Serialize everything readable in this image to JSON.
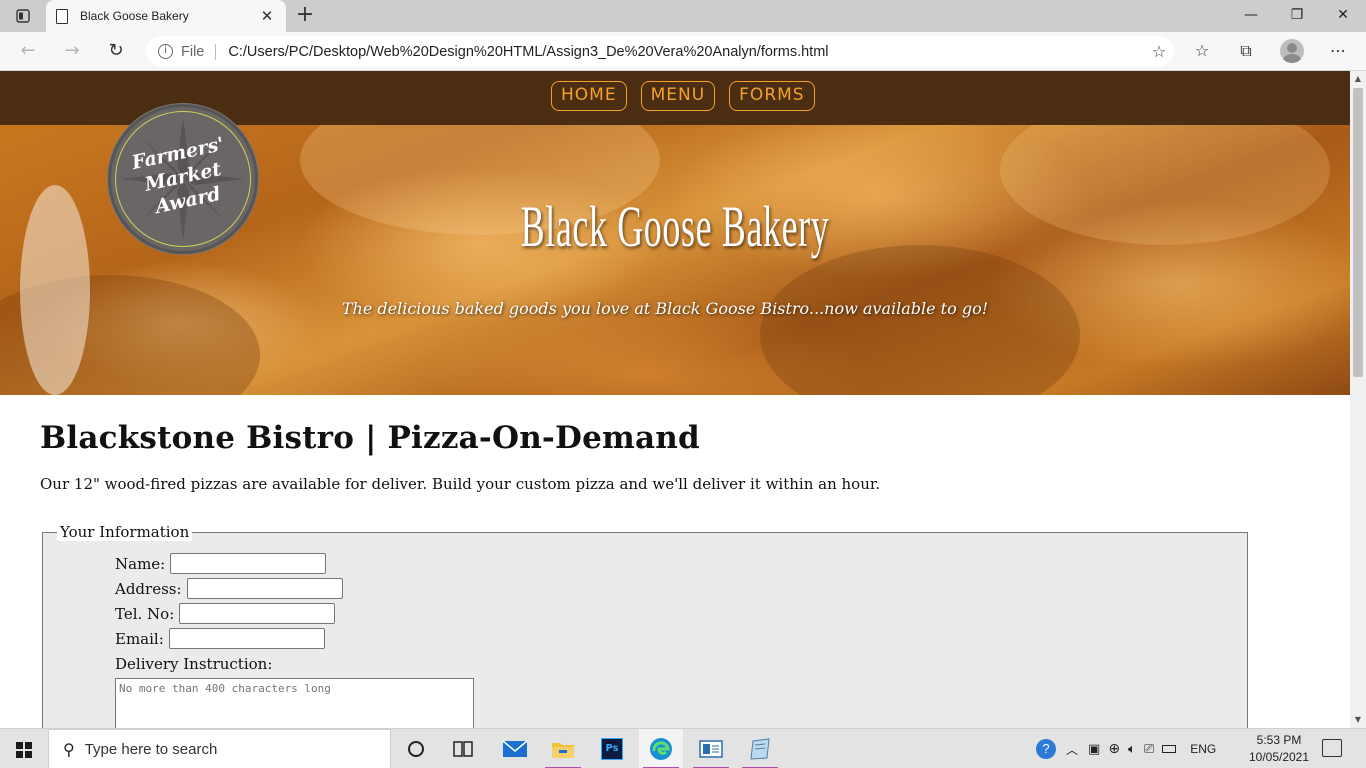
{
  "browser": {
    "tab_title": "Black Goose Bakery",
    "address_prefix": "File",
    "url": "C:/Users/PC/Desktop/Web%20Design%20HTML/Assign3_De%20Vera%20Analyn/forms.html",
    "icons": [
      "tab-actions-icon",
      "page-icon",
      "close-icon",
      "new-tab-icon",
      "minimize-icon",
      "restore-icon",
      "window-close-icon",
      "back-icon",
      "forward-icon",
      "refresh-icon",
      "info-icon",
      "add-favorite-icon",
      "favorites-icon",
      "collections-icon",
      "profile-icon",
      "more-icon"
    ]
  },
  "site": {
    "nav": [
      "HOME",
      "MENU",
      "FORMS"
    ],
    "brand": "Black Goose Bakery",
    "tagline": "The delicious baked goods you love at Black Goose Bistro...now available to go!",
    "award": [
      "Farmers'",
      "Market",
      "Award"
    ],
    "colors": {
      "nav_bg": "#4b2e12",
      "nav_accent": "#f3a12a"
    }
  },
  "page": {
    "heading": "Blackstone Bistro | Pizza-On-Demand",
    "intro": "Our 12\" wood-fired pizzas are available for deliver. Build your custom pizza and we'll deliver it within an hour.",
    "fieldset": {
      "legend": "Your Information",
      "fields": [
        {
          "label": "Name:",
          "value": ""
        },
        {
          "label": "Address:",
          "value": ""
        },
        {
          "label": "Tel. No:",
          "value": ""
        },
        {
          "label": "Email:",
          "value": ""
        }
      ],
      "textarea_label": "Delivery Instruction:",
      "textarea_placeholder": "No more than 400 characters long"
    }
  },
  "taskbar": {
    "search_placeholder": "Type here to search",
    "language": "ENG",
    "time": "5:53 PM",
    "date": "10/05/2021",
    "apps": [
      "cortana-icon",
      "task-view-icon",
      "mail-icon",
      "file-explorer-icon",
      "photoshop-icon",
      "edge-icon",
      "app-icon",
      "notepad-icon"
    ]
  }
}
